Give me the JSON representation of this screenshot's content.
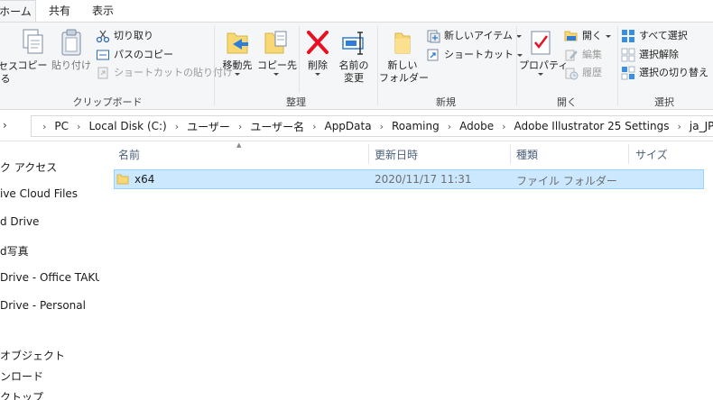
{
  "tabs": [
    "ホーム",
    "共有",
    "表示"
  ],
  "ribbon": {
    "clipboard": {
      "label": "クリップボード",
      "access_partial": [
        "セス",
        "る"
      ],
      "copy": "コピー",
      "paste": "貼り付け",
      "cut": "切り取り",
      "copy_path": "パスのコピー",
      "paste_shortcut": "ショートカットの貼り付け"
    },
    "organize": {
      "label": "整理",
      "move_to": "移動先",
      "copy_to": "コピー先",
      "delete": "削除",
      "rename_line1": "名前の",
      "rename_line2": "変更"
    },
    "new": {
      "label": "新規",
      "new_folder_line1": "新しい",
      "new_folder_line2": "フォルダー",
      "new_item": "新しいアイテム",
      "shortcut": "ショートカット"
    },
    "open": {
      "label": "開く",
      "properties": "プロパティ",
      "open": "開く",
      "edit": "編集",
      "history": "履歴"
    },
    "select": {
      "label": "選択",
      "select_all": "すべて選択",
      "select_none": "選択解除",
      "invert": "選択の切り替え"
    }
  },
  "breadcrumb": [
    "PC",
    "Local Disk (C:)",
    "ユーザー",
    "ユーザー名",
    "AppData",
    "Roaming",
    "Adobe",
    "Adobe Illustrator 25 Settings",
    "ja_JP"
  ],
  "nav_items": [
    "ク アクセス",
    "ive Cloud Files",
    "d Drive",
    "d写真",
    "Drive - Office TAKU",
    "Drive - Personal",
    "オブジェクト",
    "ンロード",
    "クトップ"
  ],
  "columns": {
    "name": "名前",
    "date": "更新日時",
    "type": "種類",
    "size": "サイズ"
  },
  "files": [
    {
      "name": "x64",
      "date": "2020/11/17 11:31",
      "type": "ファイル フォルダー",
      "size": ""
    }
  ],
  "colors": {
    "selection_bg": "#cce8ff",
    "selection_border": "#99d1ff",
    "folder_yellow": "#f8d775",
    "delete_red": "#e81123"
  }
}
